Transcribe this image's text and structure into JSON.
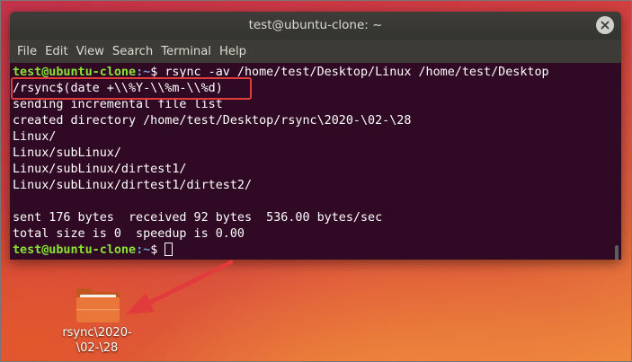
{
  "window": {
    "title": "test@ubuntu-clone: ~"
  },
  "menu": [
    "File",
    "Edit",
    "View",
    "Search",
    "Terminal",
    "Help"
  ],
  "terminal": {
    "prompt_user": "test@ubuntu-clone",
    "prompt_path": ":~",
    "prompt_symbol": "$ ",
    "command_line1": "rsync -av /home/test/Desktop/Linux /home/test/Desktop",
    "command_line2": "/rsync$(date +\\\\%Y-\\\\%m-\\\\%d)",
    "output": [
      "sending incremental file list",
      "created directory /home/test/Desktop/rsync\\2020-\\02-\\28",
      "Linux/",
      "Linux/subLinux/",
      "Linux/subLinux/dirtest1/",
      "Linux/subLinux/dirtest1/dirtest2/",
      "",
      "sent 176 bytes  received 92 bytes  536.00 bytes/sec",
      "total size is 0  speedup is 0.00"
    ]
  },
  "desktop": {
    "folder_label": "rsync\\2020-\n\\02-\\28"
  },
  "colors": {
    "terminal_bg": "#300a24",
    "prompt_green": "#8ae234",
    "prompt_blue": "#729fcf",
    "highlight_red": "#e23b3b",
    "folder_orange": "#e9773a"
  }
}
